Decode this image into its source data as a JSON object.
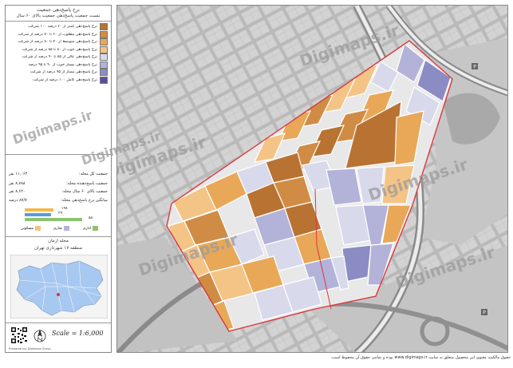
{
  "legend": {
    "title": "نرخ پاسخ‌دهی جمعیت",
    "subtitle": "نسبت جمعیت پاسخ‌دهی جمعیت بالای ۶۰ سال",
    "items": [
      {
        "label": "نرخ پاسخ‌دهی کمتر از ۶۰ درصد ۱۰۰ شرکت",
        "color": "#b87333"
      },
      {
        "label": "نرخ پاسخ‌دهی مطلوب از ۶۰ تا ۷۰ درصد از شرکت",
        "color": "#d08c45"
      },
      {
        "label": "نرخ پاسخ‌دهی متوسط از ۷۰ تا ۸۰ درصد از شرکت",
        "color": "#e8a858"
      },
      {
        "label": "نرخ پاسخ‌دهی خوب از ۸۰ تا ۸۵ درصد از شرکت",
        "color": "#f4c486"
      },
      {
        "label": "نرخ پاسخ‌دهی عالی از ۸۵ تا ۹۰ درصد از شرکت",
        "color": "#d9d9ec"
      },
      {
        "label": "نرخ پاسخ‌دهی بسیار خوب از ۹۰ تا ۹۵ درصد",
        "color": "#b3b3d9"
      },
      {
        "label": "نرخ پاسخ‌دهی ممتاز از ۹۵ درصد از شرکت",
        "color": "#8c8cc4"
      },
      {
        "label": "نرخ پاسخ‌دهی کامل ۱۰۰ درصد از شرکت",
        "color": "#5f4b9c"
      }
    ]
  },
  "stats": [
    {
      "label": "جمعیت کل محله:",
      "value": "۱۱,۰۶۴ نفر"
    },
    {
      "label": "جمعیت پاسخ‌دهنده محله:",
      "value": "۸,۷۸۸ نفر"
    },
    {
      "label": "جمعیت بالای ۶۰ سال محله:",
      "value": "۸,۶۲۰ نفر"
    },
    {
      "label": "میانگین نرخ پاسخ‌دهی محله:",
      "value": "۸۷/۷ درصد"
    }
  ],
  "bars": [
    {
      "label": "۱۹۸",
      "color": "#f2b94a",
      "fraction": 0.36
    },
    {
      "label": "۲۹",
      "color": "#5b9bd5",
      "fraction": 0.33
    },
    {
      "label": "۵۸",
      "color": "#8dc26f",
      "fraction": 0.72
    }
  ],
  "categories": [
    {
      "label": "مسکونی",
      "color": "#f2c27e"
    },
    {
      "label": "تجاری",
      "color": "#b3b3d9"
    },
    {
      "label": "اداری",
      "color": "#8dc26f"
    }
  ],
  "location": {
    "title": "محله ازمان",
    "subtitle": "منطقه ۱۷ شهرداری تهران"
  },
  "scale": "Scale = 1:6,000",
  "credit": "Prepared by: Digimaps Group",
  "watermark": "Digimaps.ir",
  "footer": "حقوق مالکیت معنوی این محصول متعلق به سایت www.digimaps.ir بوده و تمامی حقوق آن محفوظ است.",
  "colors": {
    "boundary": "#d9373e",
    "map_bg": "#b7b7b7",
    "block_bg": "#d0d0d0",
    "district_fill": "#a7c8f0"
  }
}
